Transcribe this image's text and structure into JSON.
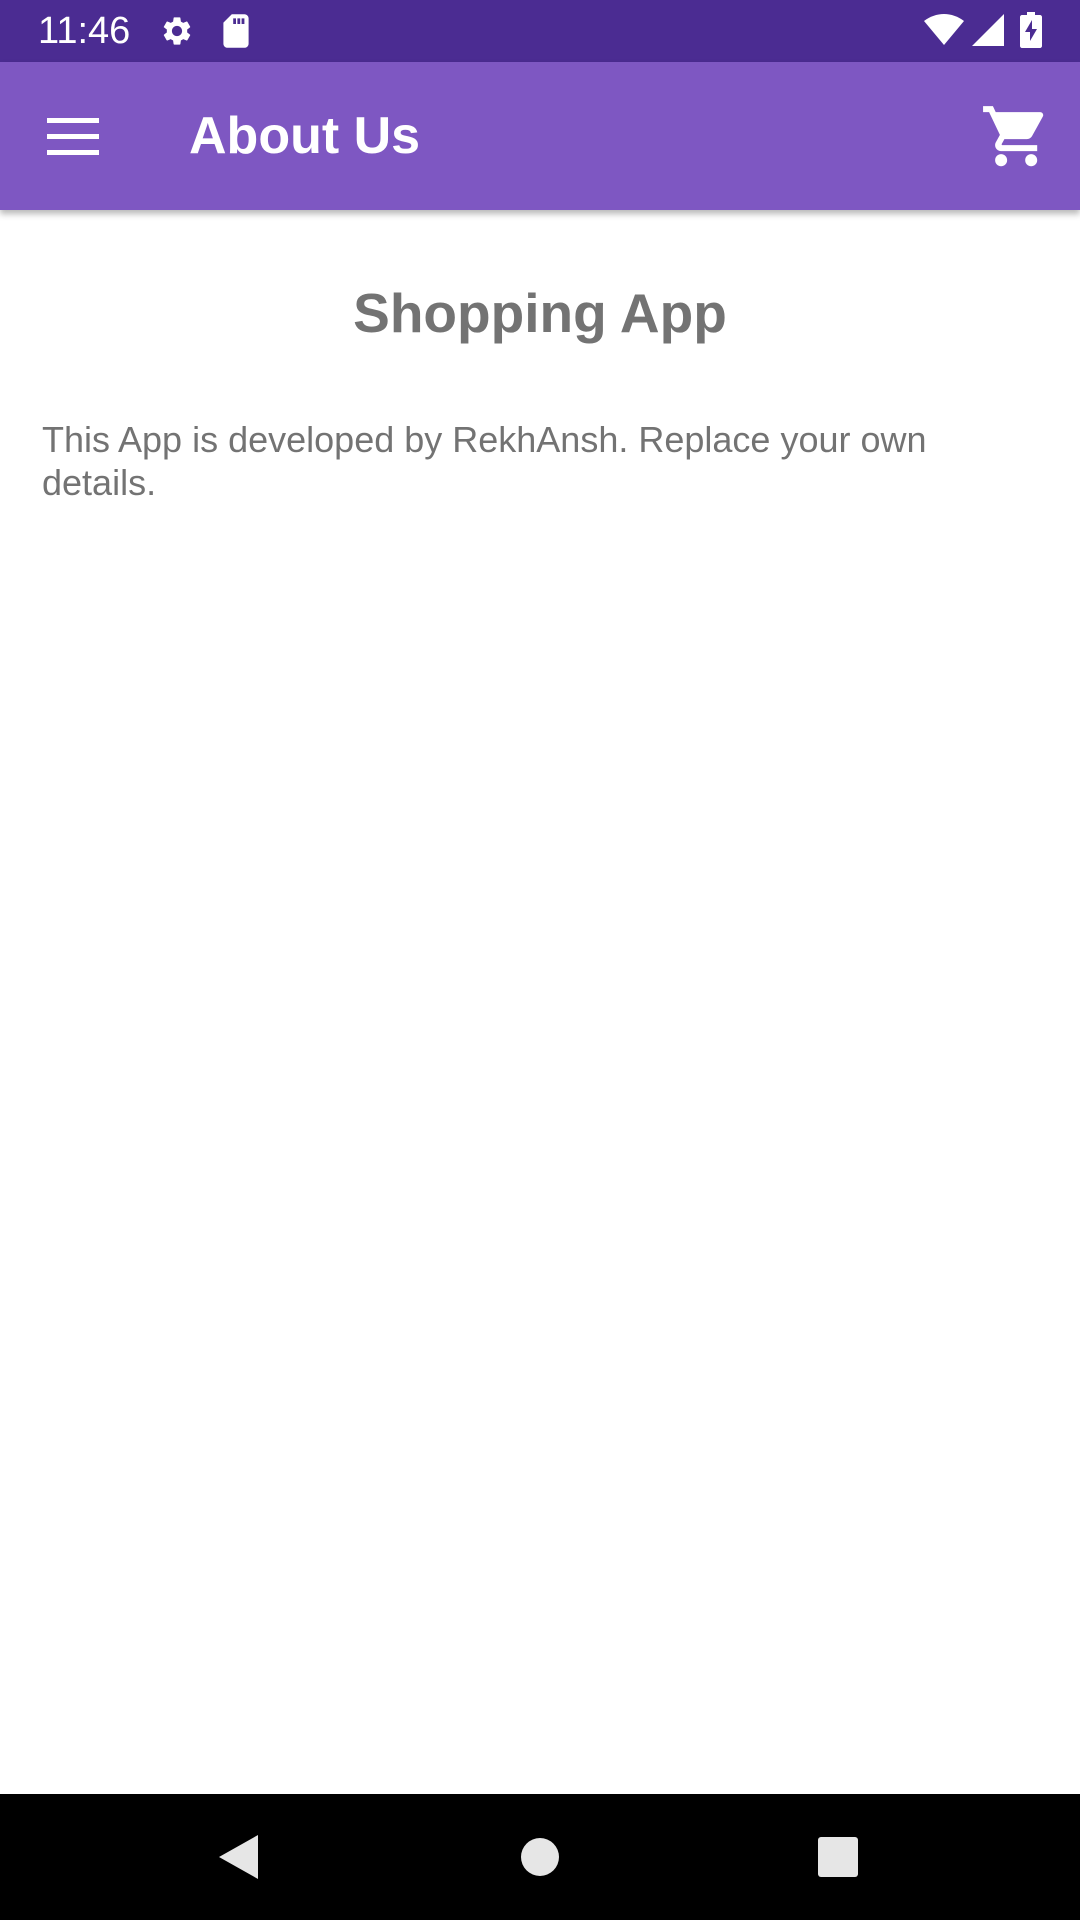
{
  "status_bar": {
    "time": "11:46",
    "icons": [
      "settings-icon",
      "sd-card-icon",
      "wifi-icon",
      "cellular-signal-icon",
      "battery-charging-icon"
    ],
    "background": "#4b2c92"
  },
  "app_bar": {
    "title": "About Us",
    "menu_icon": "hamburger-menu-icon",
    "cart_icon": "shopping-cart-icon",
    "background": "#7e57c2"
  },
  "content": {
    "heading": "Shopping App",
    "description": "This App is developed by RekhAnsh. Replace your own details.",
    "text_color": "#737373"
  },
  "nav_bar": {
    "buttons": [
      "back-icon",
      "home-icon",
      "recents-icon"
    ]
  }
}
